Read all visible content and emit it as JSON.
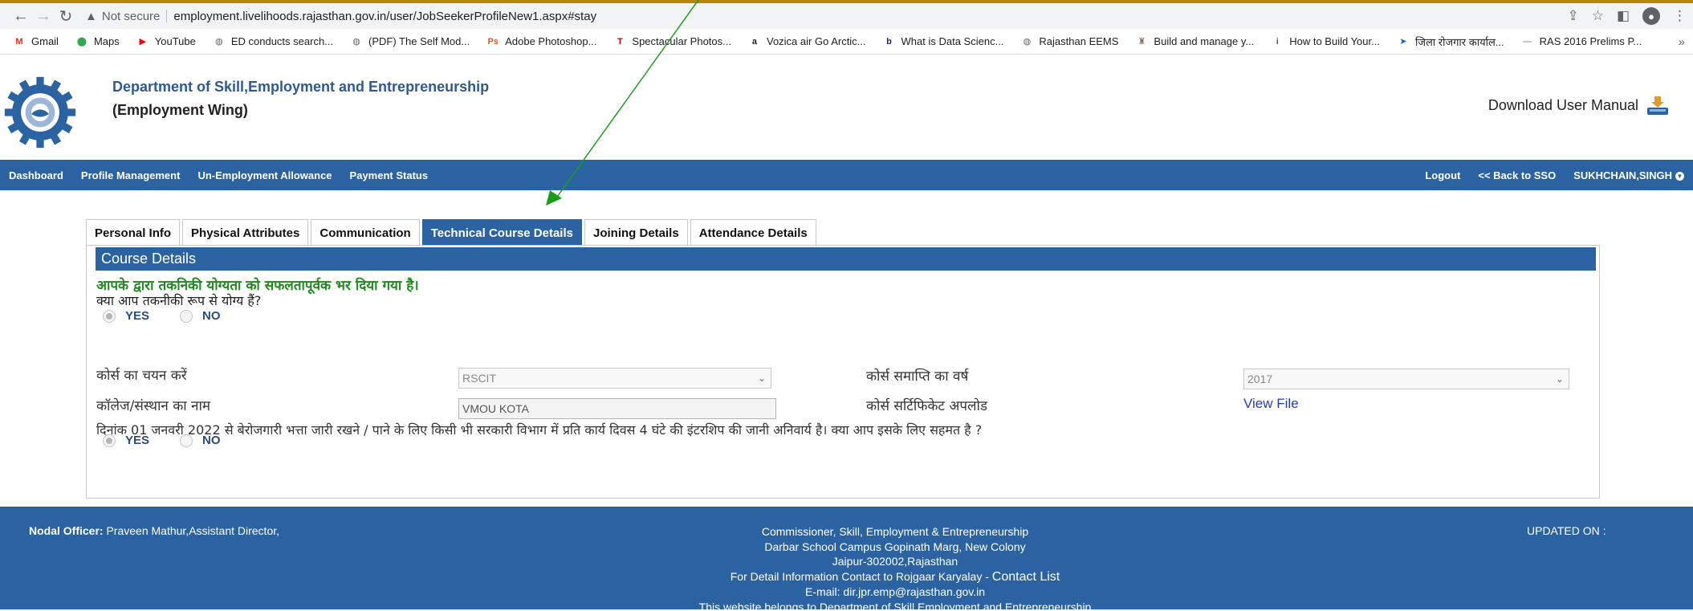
{
  "browser": {
    "not_secure": "Not secure",
    "url": "employment.livelihoods.rajasthan.gov.in/user/JobSeekerProfileNew1.aspx#stay",
    "bookmarks": [
      {
        "label": "Gmail",
        "icon": "gmail-icon",
        "color": "#d93025"
      },
      {
        "label": "Maps",
        "icon": "maps-icon",
        "color": "#34a853"
      },
      {
        "label": "YouTube",
        "icon": "youtube-icon",
        "color": "#ff0000"
      },
      {
        "label": "ED conducts search...",
        "icon": "globe-icon",
        "color": "#5f6368"
      },
      {
        "label": "(PDF) The Self Mod...",
        "icon": "globe-icon",
        "color": "#5f6368"
      },
      {
        "label": "Adobe Photoshop...",
        "icon": "photoshop-icon",
        "color": "#e2592b"
      },
      {
        "label": "Spectacular Photos...",
        "icon": "t-icon",
        "color": "#d0021b"
      },
      {
        "label": "Vozica air Go Arctic...",
        "icon": "amazon-icon",
        "color": "#222222"
      },
      {
        "label": "What is Data Scienc...",
        "icon": "b-icon",
        "color": "#1a237e"
      },
      {
        "label": "Rajasthan EEMS",
        "icon": "globe-icon",
        "color": "#5f6368"
      },
      {
        "label": "Build and manage y...",
        "icon": "emblem-icon",
        "color": "#8d6e63"
      },
      {
        "label": "How to Build Your...",
        "icon": "i-icon",
        "color": "#1565c0"
      },
      {
        "label": "जिला रोजगार कार्याल...",
        "icon": "arrow-icon",
        "color": "#1565c0"
      },
      {
        "label": "RAS 2016 Prelims P...",
        "icon": "dash-icon",
        "color": "#9e9e9e"
      }
    ]
  },
  "header": {
    "title": "Department of Skill,Employment and Entrepreneurship",
    "subtitle": "(Employment Wing)",
    "download_manual": "Download User Manual"
  },
  "nav": {
    "left": [
      "Dashboard",
      "Profile Management",
      "Un-Employment Allowance",
      "Payment Status"
    ],
    "logout": "Logout",
    "back_sso": "<< Back to SSO",
    "user": "SUKHCHAIN,SINGH"
  },
  "tabs": [
    "Personal Info",
    "Physical Attributes",
    "Communication",
    "Technical Course Details",
    "Joining Details",
    "Attendance Details"
  ],
  "active_tab": "Technical Course Details",
  "course": {
    "heading": "Course Details",
    "success_msg": "आपके द्वारा तकनिकी योग्यता को सफलतापूर्वक भर दिया गया है।",
    "q_tech": "क्या आप तकनीकी रूप से योग्य हैं?",
    "yes": "YES",
    "no": "NO",
    "course_select_label": "कोर्स का चयन करें",
    "course_select_value": "RSCIT",
    "year_label": "कोर्स समाप्ति का वर्ष",
    "year_value": "2017",
    "college_label": "कॉलेज/संस्थान का नाम",
    "college_value": "VMOU KOTA",
    "cert_label": "कोर्स सर्टिफिकेट अपलोड",
    "view_file": "View File",
    "q_intern": "दिनांक 01 जनवरी 2022 से बेरोजगारी भत्ता जारी रखने / पाने के लिए किसी भी सरकारी विभाग में प्रति कार्य दिवस 4 घंटे की इंटरशिप की जानी अनिवार्य है। क्या आप इसके लिए सहमत है ?"
  },
  "footer": {
    "nodal_label": "Nodal Officer:",
    "nodal_value": " Praveen Mathur,Assistant Director,",
    "updated": "UPDATED ON :",
    "line1": "Commissioner, Skill, Employment & Entrepreneurship",
    "line2": "Darbar School Campus Gopinath Marg, New Colony",
    "line3": "Jaipur-302002,Rajasthan",
    "line4": "For Detail Information Contact to Rojgaar Karyalay - ",
    "contact_list": "Contact List",
    "line5": "E-mail: dir.jpr.emp@rajasthan.gov.in",
    "line6": "This website belongs to Department of Skill,Employment and Entrepreneurship"
  },
  "colors": {
    "primary": "#2b63a2",
    "success": "#1d8a1d",
    "annotation_arrow": "#1a9e1a"
  }
}
